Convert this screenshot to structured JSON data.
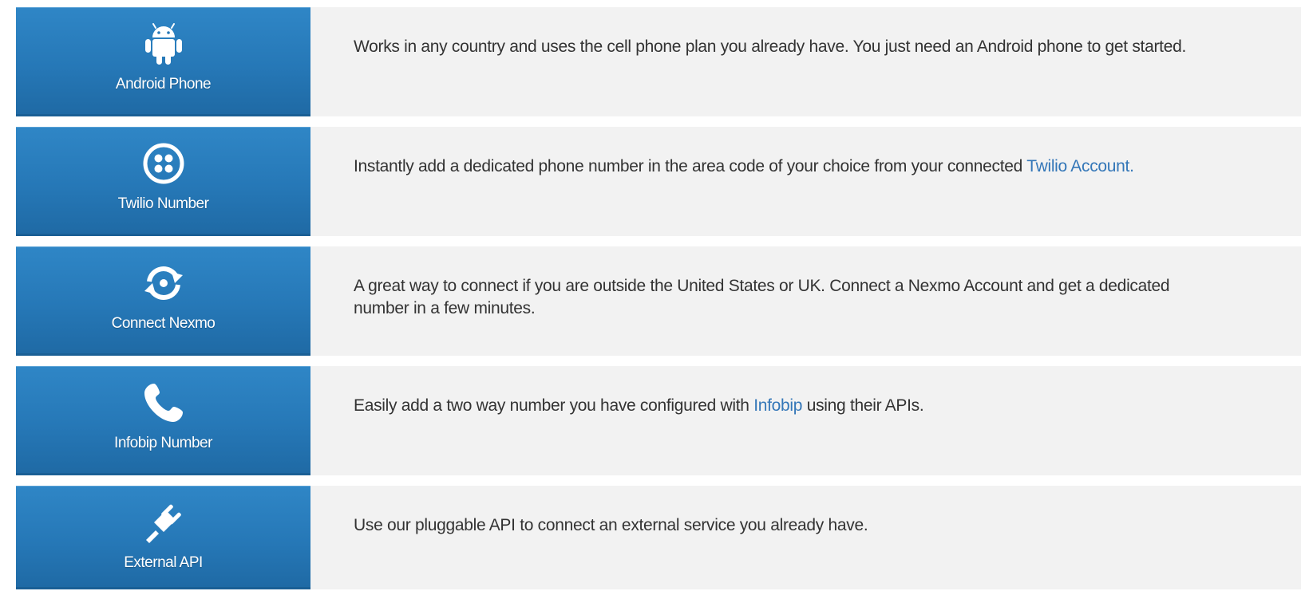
{
  "options": [
    {
      "label": "Android Phone",
      "icon": "android-icon",
      "desc_before": "Works in any country and uses the cell phone plan you already have. You just need an Android phone to get started.",
      "link": "",
      "desc_after": ""
    },
    {
      "label": "Twilio Number",
      "icon": "twilio-icon",
      "desc_before": "Instantly add a dedicated phone number in the area code of your choice from your connected ",
      "link": "Twilio Account.",
      "desc_after": ""
    },
    {
      "label": "Connect Nexmo",
      "icon": "refresh-icon",
      "desc_before": "A great way to connect if you are outside the United States or UK. Connect a Nexmo Account and get a dedicated number in a few minutes.",
      "link": "",
      "desc_after": ""
    },
    {
      "label": "Infobip Number",
      "icon": "phone-icon",
      "desc_before": "Easily add a two way number you have configured with ",
      "link": "Infobip",
      "desc_after": " using their APIs."
    },
    {
      "label": "External API",
      "icon": "plug-icon",
      "desc_before": "Use our pluggable API to connect an external service you already have.",
      "link": "",
      "desc_after": ""
    }
  ],
  "colors": {
    "tile": "#2678b7",
    "link": "#3477b8",
    "panel": "#f2f2f2"
  }
}
